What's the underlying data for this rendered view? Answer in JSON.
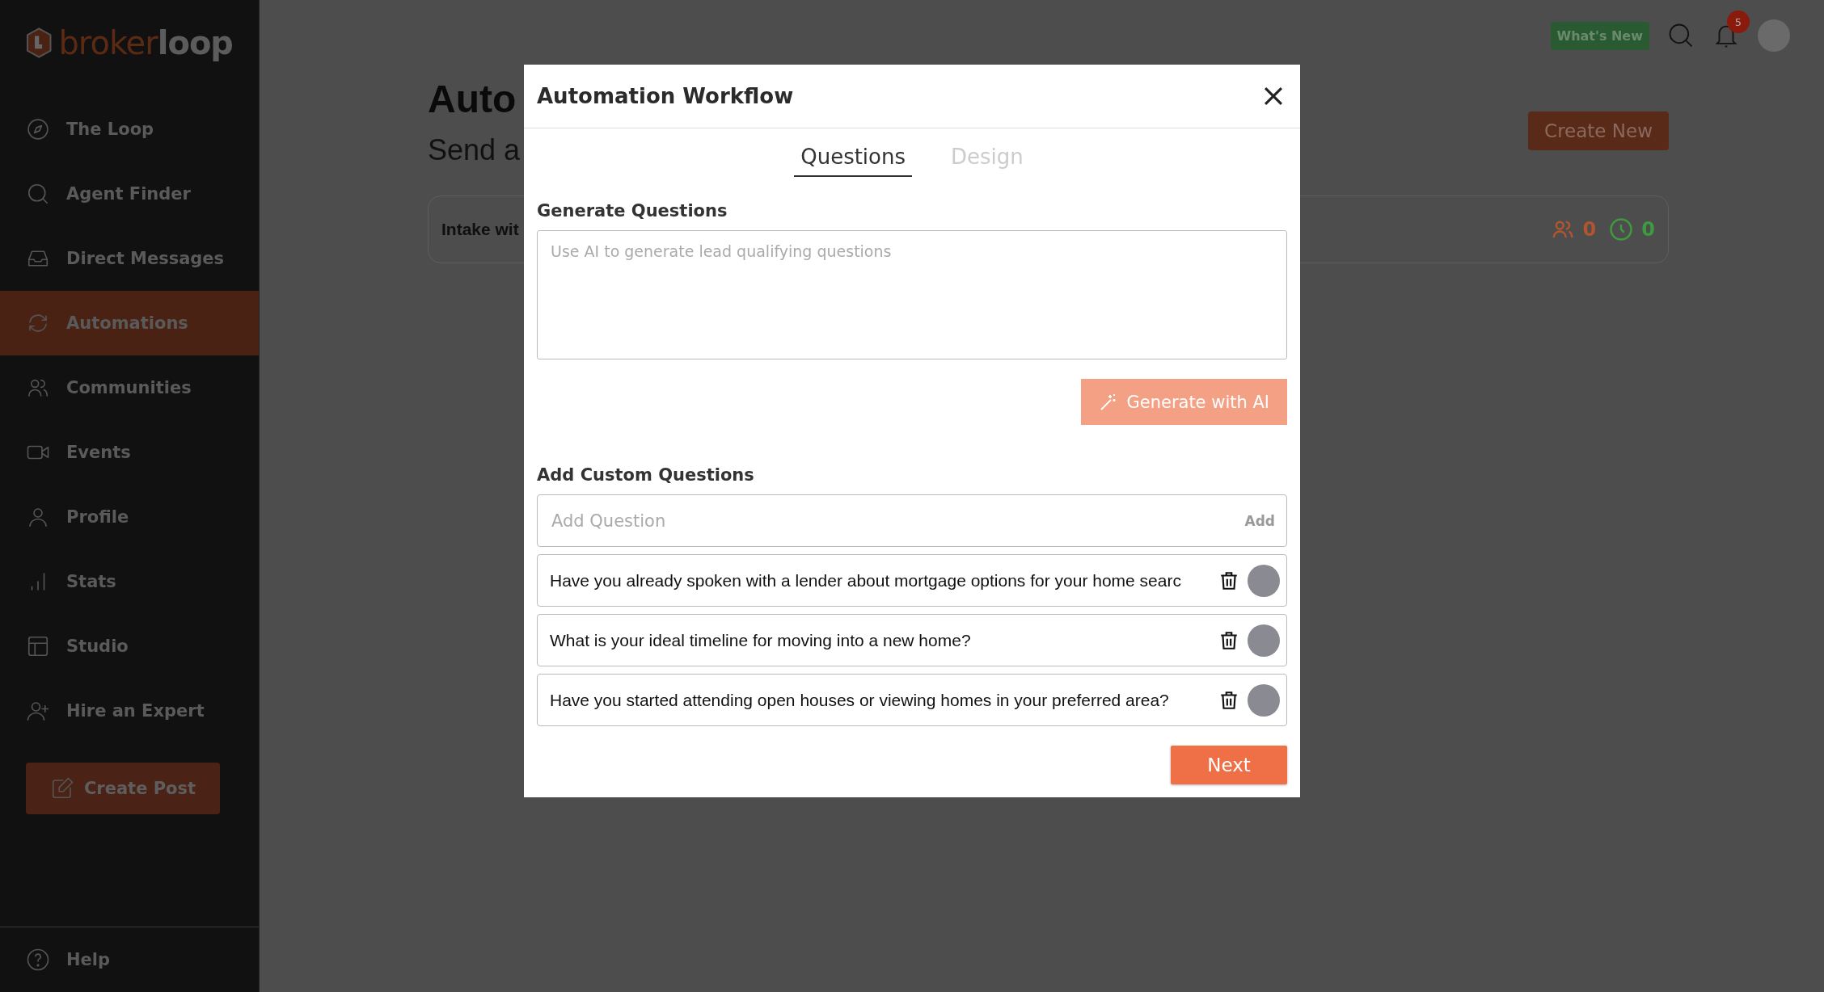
{
  "logo": {
    "part_1": "broker",
    "part_2": "loop"
  },
  "sidebar": {
    "items": [
      {
        "label": "The Loop",
        "selected": false
      },
      {
        "label": "Agent Finder",
        "selected": false
      },
      {
        "label": "Direct Messages",
        "selected": false
      },
      {
        "label": "Automations",
        "selected": true
      },
      {
        "label": "Communities",
        "selected": false
      },
      {
        "label": "Events",
        "selected": false
      },
      {
        "label": "Profile",
        "selected": false
      },
      {
        "label": "Stats",
        "selected": false
      },
      {
        "label": "Studio",
        "selected": false
      },
      {
        "label": "Hire an Expert",
        "selected": false
      }
    ],
    "create_post": "Create Post",
    "help": "Help"
  },
  "topbar": {
    "whats_new": "What's New",
    "notification_badge": "5"
  },
  "page": {
    "title": "Auto",
    "subtitle": "Send a",
    "create_new": "Create New",
    "card": {
      "title": "Intake wit",
      "people_count": "0",
      "clock_count": "0"
    }
  },
  "modal": {
    "title": "Automation Workflow",
    "tabs": [
      {
        "label": "Questions",
        "selected": true
      },
      {
        "label": "Design",
        "selected": false
      }
    ],
    "generate": {
      "label": "Generate Questions",
      "placeholder": "Use AI to generate lead qualifying questions",
      "button": "Generate with AI"
    },
    "custom": {
      "label": "Add Custom Questions",
      "placeholder": "Add Question",
      "add_button": "Add",
      "questions": [
        {
          "text": "Have you already spoken with a lender about mortgage options for your home searc"
        },
        {
          "text": "What is your ideal timeline for moving into a new home?"
        },
        {
          "text": "Have you started attending open houses or viewing homes in your preferred area?"
        }
      ]
    },
    "next": "Next"
  }
}
